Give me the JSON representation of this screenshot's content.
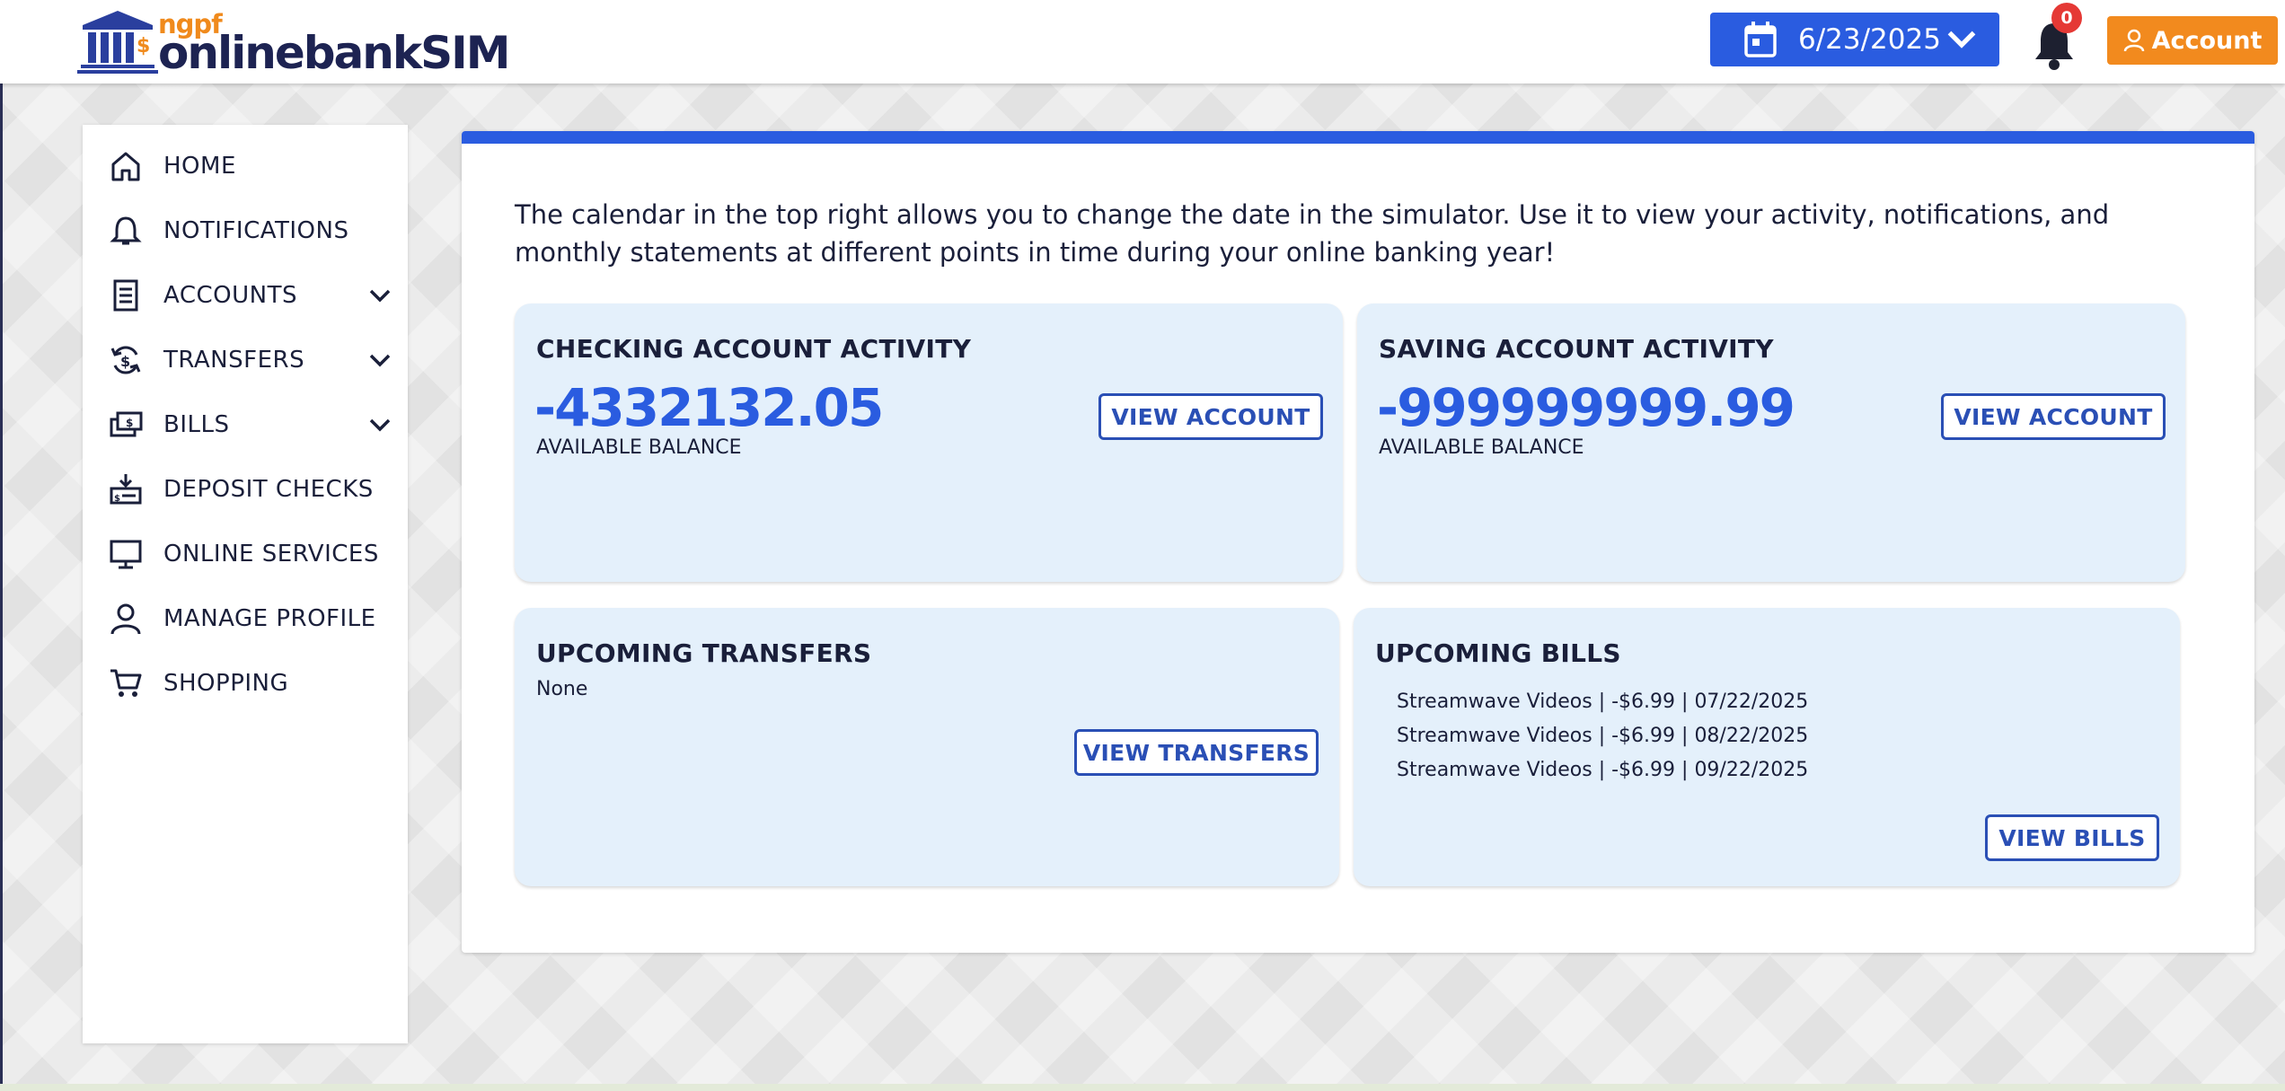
{
  "header": {
    "logo_small": "ngpf",
    "logo_main": "onlinebankSIM",
    "date": "6/23/2025",
    "notification_count": "0",
    "account_label": "Account"
  },
  "sidebar": {
    "items": [
      {
        "label": "HOME",
        "icon": "home-icon",
        "has_chevron": false
      },
      {
        "label": "NOTIFICATIONS",
        "icon": "bell-icon",
        "has_chevron": false
      },
      {
        "label": "ACCOUNTS",
        "icon": "document-icon",
        "has_chevron": true
      },
      {
        "label": "TRANSFERS",
        "icon": "transfer-icon",
        "has_chevron": true
      },
      {
        "label": "BILLS",
        "icon": "bills-icon",
        "has_chevron": true
      },
      {
        "label": "DEPOSIT CHECKS",
        "icon": "deposit-check-icon",
        "has_chevron": false
      },
      {
        "label": "ONLINE SERVICES",
        "icon": "monitor-icon",
        "has_chevron": false
      },
      {
        "label": "MANAGE PROFILE",
        "icon": "user-icon",
        "has_chevron": false
      },
      {
        "label": "SHOPPING",
        "icon": "cart-icon",
        "has_chevron": false
      }
    ]
  },
  "main": {
    "intro": "The calendar in the top right allows you to change the date in the simulator. Use it to view your activity, notifications, and monthly statements at different points in time during your online banking year!",
    "checking": {
      "title": "CHECKING ACCOUNT ACTIVITY",
      "amount": "-4332132.05",
      "sub": "AVAILABLE BALANCE",
      "button": "VIEW ACCOUNT"
    },
    "saving": {
      "title": "SAVING ACCOUNT ACTIVITY",
      "amount": "-999999999.99",
      "sub": "AVAILABLE BALANCE",
      "button": "VIEW ACCOUNT"
    },
    "transfers": {
      "title": "UPCOMING TRANSFERS",
      "value": "None",
      "button": "VIEW TRANSFERS"
    },
    "bills": {
      "title": "UPCOMING BILLS",
      "items": [
        "Streamwave Videos | -$6.99 | 07/22/2025",
        "Streamwave Videos | -$6.99 | 08/22/2025",
        "Streamwave Videos | -$6.99 | 09/22/2025"
      ],
      "button": "VIEW BILLS"
    }
  },
  "colors": {
    "primary_blue": "#2a5ce0",
    "accent_orange": "#f28a1e",
    "navy": "#1d2352",
    "card_bg": "#e4f0fb",
    "badge_red": "#e53935"
  }
}
